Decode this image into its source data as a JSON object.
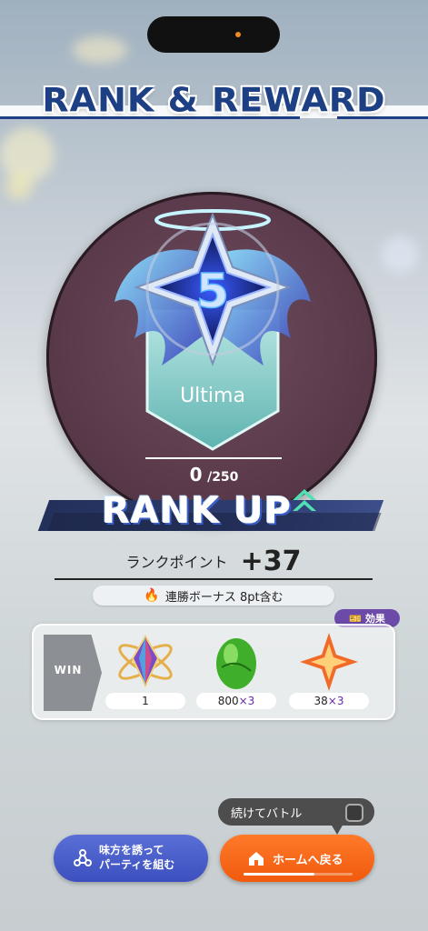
{
  "header": {
    "title": "RANK & REWARD"
  },
  "rank": {
    "name": "Ultima",
    "level": "5",
    "points_current": "0",
    "points_separator": "/",
    "points_max": "250"
  },
  "rank_up": {
    "label": "RANK UP"
  },
  "rank_points": {
    "label": "ランクポイント",
    "value": "+37"
  },
  "bonus": {
    "text": "連勝ボーナス 8pt含む"
  },
  "effect_badge": {
    "label": "効果"
  },
  "win": {
    "label": "WIN"
  },
  "rewards": [
    {
      "icon": "atom-crystal-icon",
      "count": "1",
      "multiplier": ""
    },
    {
      "icon": "green-egg-icon",
      "count": "800",
      "multiplier": "×3"
    },
    {
      "icon": "orange-star-crystal-icon",
      "count": "38",
      "multiplier": "×3"
    }
  ],
  "continue_battle": {
    "label": "続けてバトル",
    "checked": false
  },
  "buttons": {
    "party_line1": "味方を誘って",
    "party_line2": "パーティを組む",
    "home": "ホームへ戻る",
    "home_progress": 0.65
  },
  "colors": {
    "title": "#1d3f83",
    "home_button": "#f05a0e",
    "party_button": "#3c4fbf",
    "effect_badge": "#6b4aa8"
  }
}
